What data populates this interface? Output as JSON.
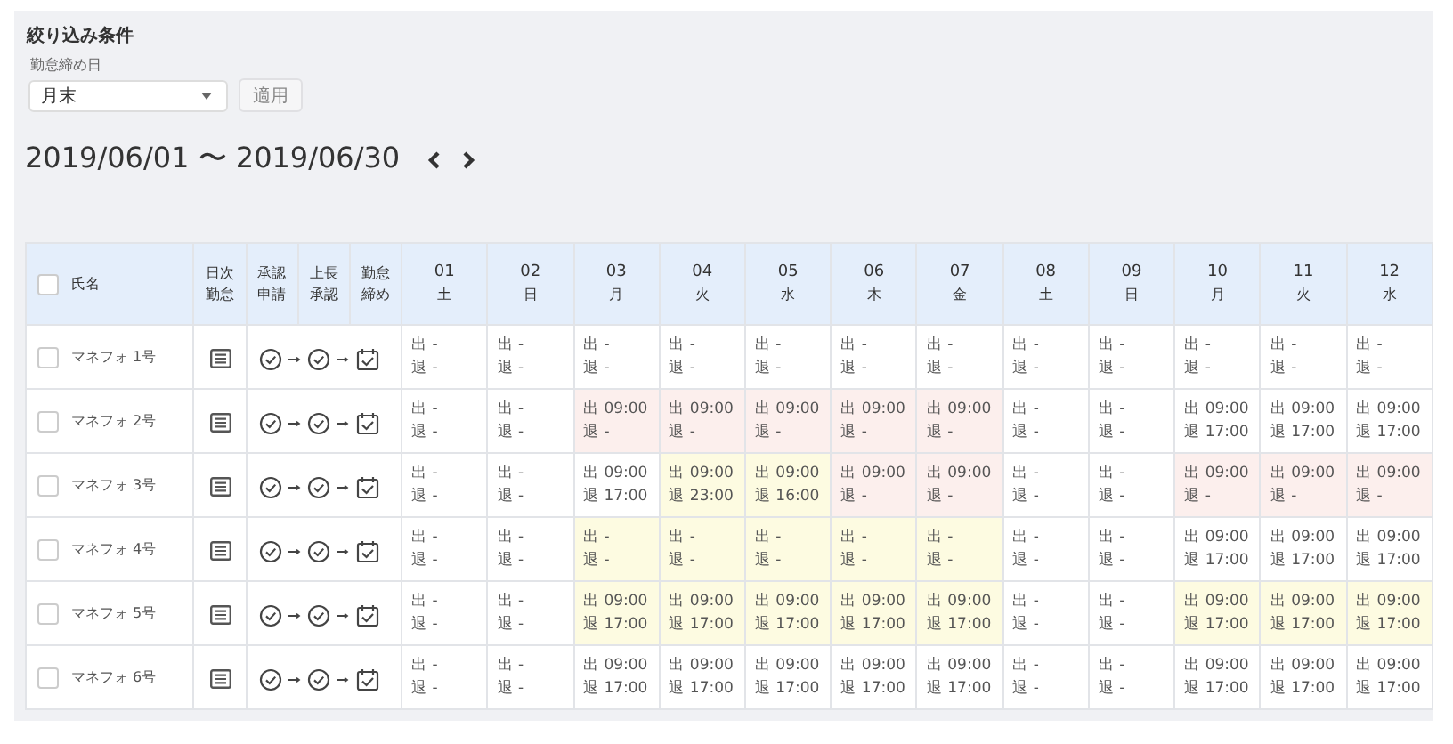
{
  "filter": {
    "title": "絞り込み条件",
    "field_label": "勤怠締め日",
    "select_value": "月末",
    "apply_button": "適用"
  },
  "period": {
    "range": "2019/06/01 〜 2019/06/30"
  },
  "table": {
    "select_all_checked": false,
    "name_header": "氏名",
    "status_headers": [
      [
        "日次",
        "勤怠"
      ],
      [
        "承認",
        "申請"
      ],
      [
        "上長",
        "承認"
      ],
      [
        "勤怠",
        "締め"
      ]
    ],
    "days": [
      {
        "date": "01",
        "weekday": "土"
      },
      {
        "date": "02",
        "weekday": "日"
      },
      {
        "date": "03",
        "weekday": "月"
      },
      {
        "date": "04",
        "weekday": "火"
      },
      {
        "date": "05",
        "weekday": "水"
      },
      {
        "date": "06",
        "weekday": "木"
      },
      {
        "date": "07",
        "weekday": "金"
      },
      {
        "date": "08",
        "weekday": "土"
      },
      {
        "date": "09",
        "weekday": "日"
      },
      {
        "date": "10",
        "weekday": "月"
      },
      {
        "date": "11",
        "weekday": "火"
      },
      {
        "date": "12",
        "weekday": "水"
      }
    ],
    "rows": [
      {
        "name": "マネフォ 1号",
        "checked": false,
        "cells": [
          {
            "in": "出 -",
            "out": "退 -",
            "error": false,
            "warning": false
          },
          {
            "in": "出 -",
            "out": "退 -",
            "error": false,
            "warning": false
          },
          {
            "in": "出 -",
            "out": "退 -",
            "error": false,
            "warning": false
          },
          {
            "in": "出 -",
            "out": "退 -",
            "error": false,
            "warning": false
          },
          {
            "in": "出 -",
            "out": "退 -",
            "error": false,
            "warning": false
          },
          {
            "in": "出 -",
            "out": "退 -",
            "error": false,
            "warning": false
          },
          {
            "in": "出 -",
            "out": "退 -",
            "error": false,
            "warning": false
          },
          {
            "in": "出 -",
            "out": "退 -",
            "error": false,
            "warning": false
          },
          {
            "in": "出 -",
            "out": "退 -",
            "error": false,
            "warning": false
          },
          {
            "in": "出 -",
            "out": "退 -",
            "error": false,
            "warning": false
          },
          {
            "in": "出 -",
            "out": "退 -",
            "error": false,
            "warning": false
          },
          {
            "in": "出 -",
            "out": "退 -",
            "error": false,
            "warning": false
          }
        ]
      },
      {
        "name": "マネフォ 2号",
        "checked": false,
        "cells": [
          {
            "in": "出 -",
            "out": "退 -",
            "error": false,
            "warning": false
          },
          {
            "in": "出 -",
            "out": "退 -",
            "error": false,
            "warning": false
          },
          {
            "in": "出 09:00",
            "out": "退 -",
            "error": true,
            "warning": false
          },
          {
            "in": "出 09:00",
            "out": "退 -",
            "error": true,
            "warning": false
          },
          {
            "in": "出 09:00",
            "out": "退 -",
            "error": true,
            "warning": false
          },
          {
            "in": "出 09:00",
            "out": "退 -",
            "error": true,
            "warning": false
          },
          {
            "in": "出 09:00",
            "out": "退 -",
            "error": true,
            "warning": false
          },
          {
            "in": "出 -",
            "out": "退 -",
            "error": false,
            "warning": false
          },
          {
            "in": "出 -",
            "out": "退 -",
            "error": false,
            "warning": false
          },
          {
            "in": "出 09:00",
            "out": "退 17:00",
            "error": false,
            "warning": false
          },
          {
            "in": "出 09:00",
            "out": "退 17:00",
            "error": false,
            "warning": false
          },
          {
            "in": "出 09:00",
            "out": "退 17:00",
            "error": false,
            "warning": false
          }
        ]
      },
      {
        "name": "マネフォ 3号",
        "checked": false,
        "cells": [
          {
            "in": "出 -",
            "out": "退 -",
            "error": false,
            "warning": false
          },
          {
            "in": "出 -",
            "out": "退 -",
            "error": false,
            "warning": false
          },
          {
            "in": "出 09:00",
            "out": "退 17:00",
            "error": false,
            "warning": false
          },
          {
            "in": "出 09:00",
            "out": "退 23:00",
            "error": false,
            "warning": true
          },
          {
            "in": "出 09:00",
            "out": "退 16:00",
            "error": false,
            "warning": true
          },
          {
            "in": "出 09:00",
            "out": "退 -",
            "error": true,
            "warning": false
          },
          {
            "in": "出 09:00",
            "out": "退 -",
            "error": true,
            "warning": false
          },
          {
            "in": "出 -",
            "out": "退 -",
            "error": false,
            "warning": false
          },
          {
            "in": "出 -",
            "out": "退 -",
            "error": false,
            "warning": false
          },
          {
            "in": "出 09:00",
            "out": "退 -",
            "error": true,
            "warning": false
          },
          {
            "in": "出 09:00",
            "out": "退 -",
            "error": true,
            "warning": false
          },
          {
            "in": "出 09:00",
            "out": "退 -",
            "error": true,
            "warning": false
          }
        ]
      },
      {
        "name": "マネフォ 4号",
        "checked": false,
        "cells": [
          {
            "in": "出 -",
            "out": "退 -",
            "error": false,
            "warning": false
          },
          {
            "in": "出 -",
            "out": "退 -",
            "error": false,
            "warning": false
          },
          {
            "in": "出 -",
            "out": "退 -",
            "error": false,
            "warning": true
          },
          {
            "in": "出 -",
            "out": "退 -",
            "error": false,
            "warning": true
          },
          {
            "in": "出 -",
            "out": "退 -",
            "error": false,
            "warning": true
          },
          {
            "in": "出 -",
            "out": "退 -",
            "error": false,
            "warning": true
          },
          {
            "in": "出 -",
            "out": "退 -",
            "error": false,
            "warning": true
          },
          {
            "in": "出 -",
            "out": "退 -",
            "error": false,
            "warning": false
          },
          {
            "in": "出 -",
            "out": "退 -",
            "error": false,
            "warning": false
          },
          {
            "in": "出 09:00",
            "out": "退 17:00",
            "error": false,
            "warning": false
          },
          {
            "in": "出 09:00",
            "out": "退 17:00",
            "error": false,
            "warning": false
          },
          {
            "in": "出 09:00",
            "out": "退 17:00",
            "error": false,
            "warning": false
          }
        ]
      },
      {
        "name": "マネフォ 5号",
        "checked": false,
        "cells": [
          {
            "in": "出 -",
            "out": "退 -",
            "error": false,
            "warning": false
          },
          {
            "in": "出 -",
            "out": "退 -",
            "error": false,
            "warning": false
          },
          {
            "in": "出 09:00",
            "out": "退 17:00",
            "error": false,
            "warning": true
          },
          {
            "in": "出 09:00",
            "out": "退 17:00",
            "error": false,
            "warning": true
          },
          {
            "in": "出 09:00",
            "out": "退 17:00",
            "error": false,
            "warning": true
          },
          {
            "in": "出 09:00",
            "out": "退 17:00",
            "error": false,
            "warning": true
          },
          {
            "in": "出 09:00",
            "out": "退 17:00",
            "error": false,
            "warning": true
          },
          {
            "in": "出 -",
            "out": "退 -",
            "error": false,
            "warning": false
          },
          {
            "in": "出 -",
            "out": "退 -",
            "error": false,
            "warning": false
          },
          {
            "in": "出 09:00",
            "out": "退 17:00",
            "error": false,
            "warning": true
          },
          {
            "in": "出 09:00",
            "out": "退 17:00",
            "error": false,
            "warning": true
          },
          {
            "in": "出 09:00",
            "out": "退 17:00",
            "error": false,
            "warning": true
          }
        ]
      },
      {
        "name": "マネフォ 6号",
        "checked": false,
        "cells": [
          {
            "in": "出 -",
            "out": "退 -",
            "error": false,
            "warning": false
          },
          {
            "in": "出 -",
            "out": "退 -",
            "error": false,
            "warning": false
          },
          {
            "in": "出 09:00",
            "out": "退 17:00",
            "error": false,
            "warning": false
          },
          {
            "in": "出 09:00",
            "out": "退 17:00",
            "error": false,
            "warning": false
          },
          {
            "in": "出 09:00",
            "out": "退 17:00",
            "error": false,
            "warning": false
          },
          {
            "in": "出 09:00",
            "out": "退 17:00",
            "error": false,
            "warning": false
          },
          {
            "in": "出 09:00",
            "out": "退 17:00",
            "error": false,
            "warning": false
          },
          {
            "in": "出 -",
            "out": "退 -",
            "error": false,
            "warning": false
          },
          {
            "in": "出 -",
            "out": "退 -",
            "error": false,
            "warning": false
          },
          {
            "in": "出 09:00",
            "out": "退 17:00",
            "error": false,
            "warning": false
          },
          {
            "in": "出 09:00",
            "out": "退 17:00",
            "error": false,
            "warning": false
          },
          {
            "in": "出 09:00",
            "out": "退 17:00",
            "error": false,
            "warning": false
          }
        ]
      }
    ]
  }
}
